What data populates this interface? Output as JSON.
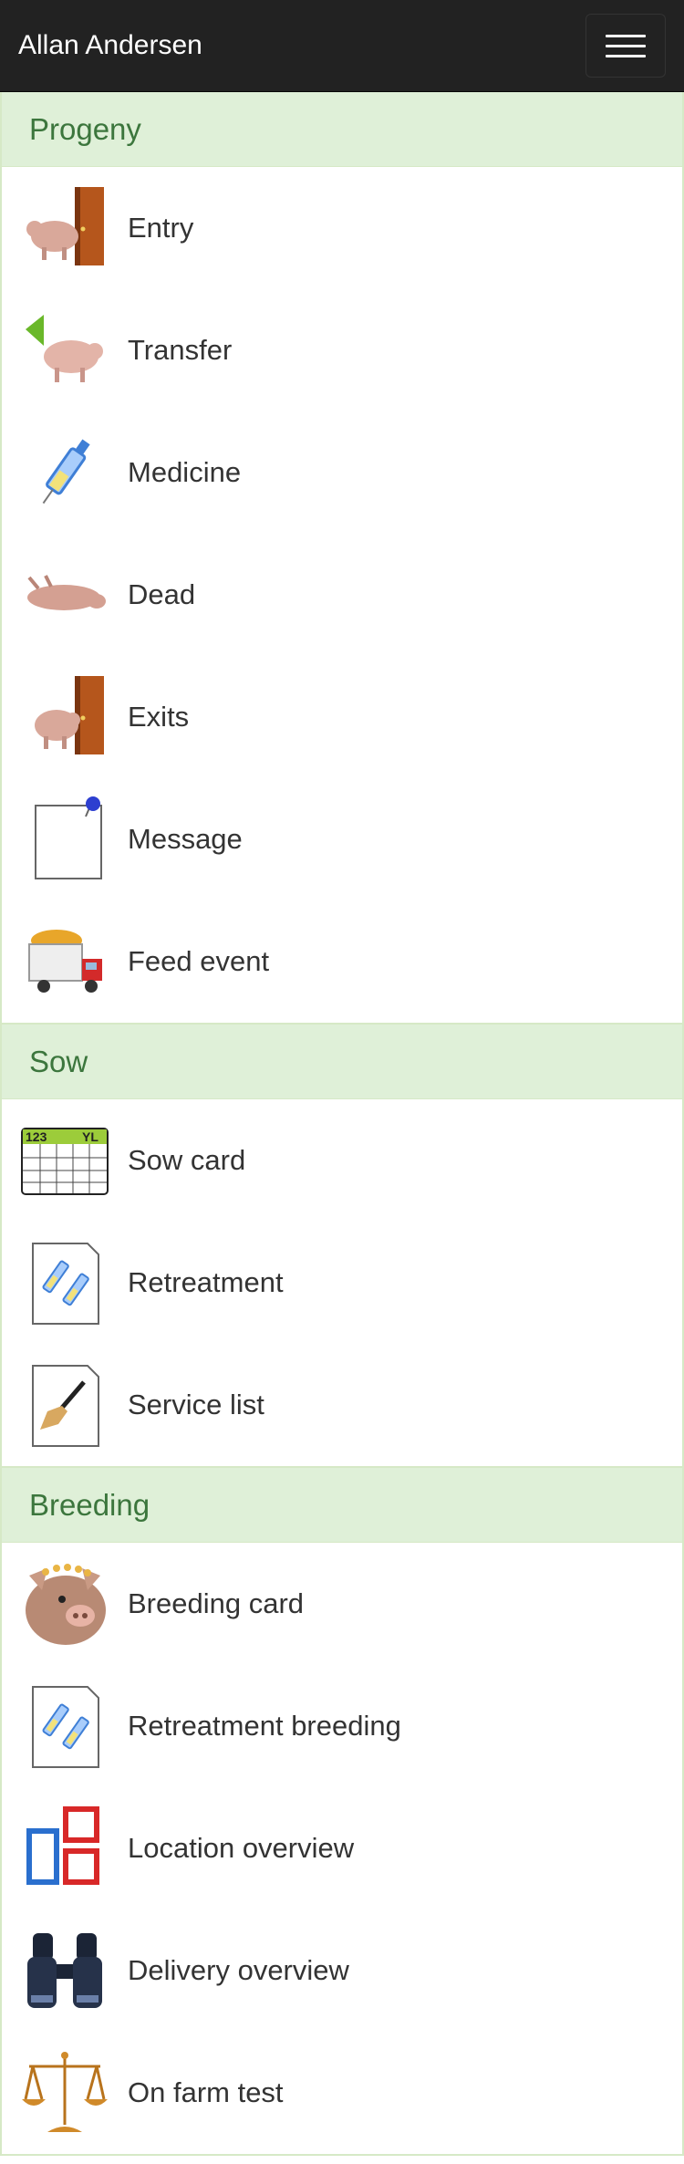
{
  "navbar": {
    "brand": "Allan Andersen",
    "menu_icon": "hamburger-icon"
  },
  "sections": [
    {
      "title": "Progeny",
      "items": [
        {
          "label": "Entry",
          "icon": "pig-door-icon"
        },
        {
          "label": "Transfer",
          "icon": "pig-arrow-icon"
        },
        {
          "label": "Medicine",
          "icon": "syringe-icon"
        },
        {
          "label": "Dead",
          "icon": "dead-pig-icon"
        },
        {
          "label": "Exits",
          "icon": "pig-door-icon"
        },
        {
          "label": "Message",
          "icon": "note-pin-icon"
        },
        {
          "label": "Feed event",
          "icon": "feed-truck-icon"
        }
      ]
    },
    {
      "title": "Sow",
      "items": [
        {
          "label": "Sow card",
          "icon": "calendar-card-icon"
        },
        {
          "label": "Retreatment",
          "icon": "syringes-document-icon"
        },
        {
          "label": "Service list",
          "icon": "brush-document-icon"
        }
      ]
    },
    {
      "title": "Breeding",
      "items": [
        {
          "label": "Breeding card",
          "icon": "pig-face-icon"
        },
        {
          "label": "Retreatment breeding",
          "icon": "syringes-document-icon"
        },
        {
          "label": "Location overview",
          "icon": "location-boxes-icon"
        },
        {
          "label": "Delivery overview",
          "icon": "binoculars-icon"
        },
        {
          "label": "On farm test",
          "icon": "scales-icon"
        }
      ]
    }
  ]
}
